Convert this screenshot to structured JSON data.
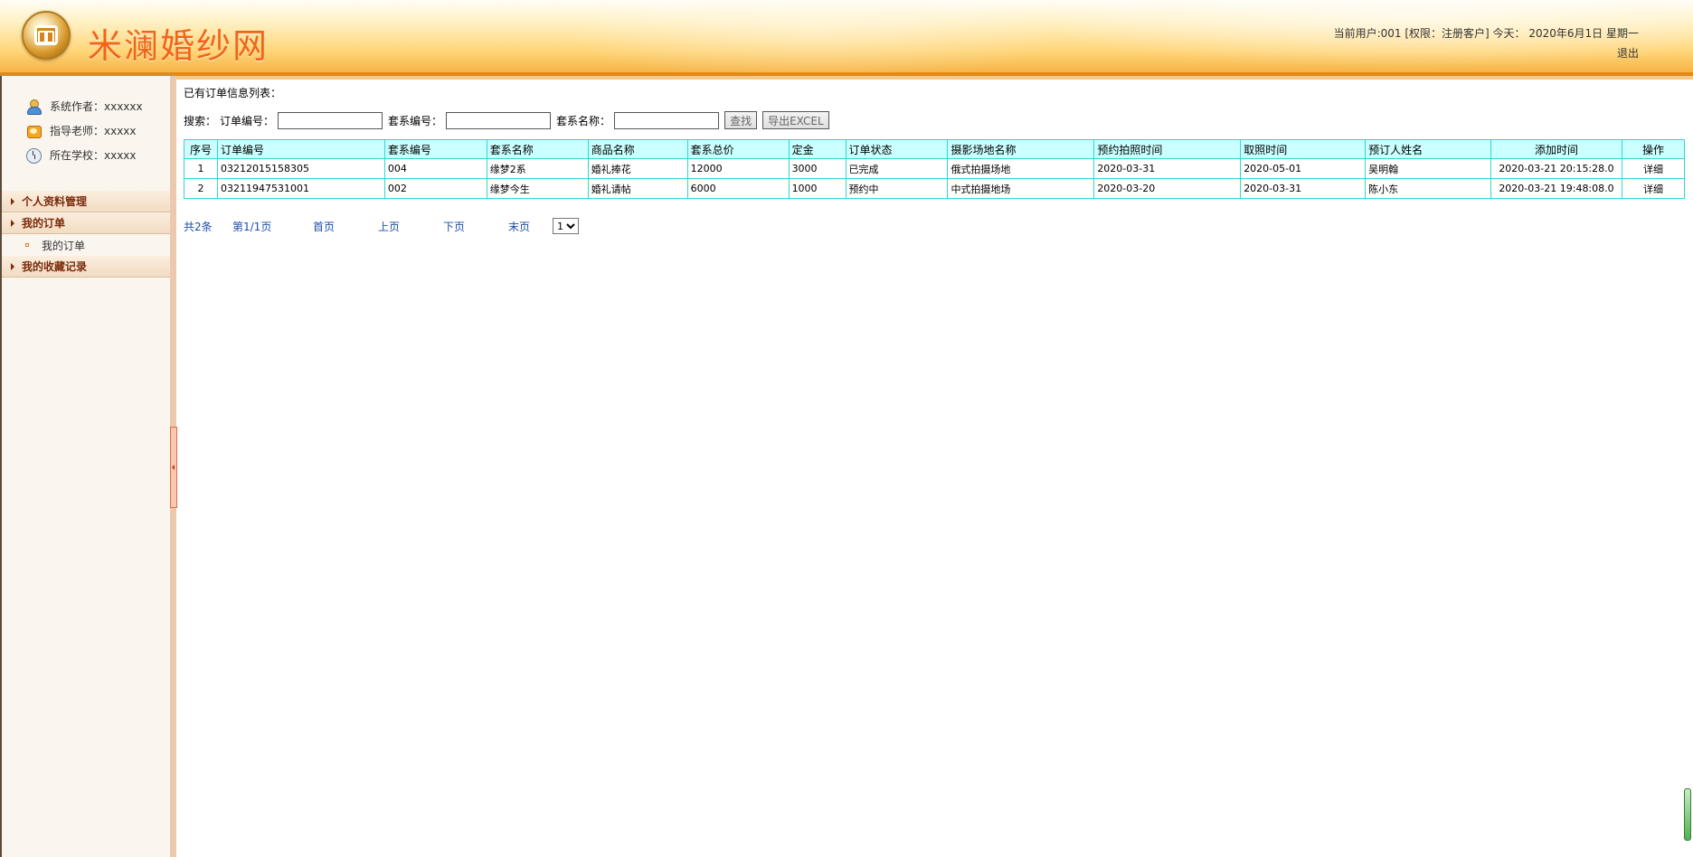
{
  "header": {
    "site_title": "米澜婚纱网",
    "user_line": "当前用户:001 [权限：注册客户] 今天： 2020年6月1日 星期一",
    "logout": "退出",
    "colors": {
      "accent": "#f0651a",
      "bar": "#e08a1c"
    }
  },
  "sidebar": {
    "info": [
      {
        "icon": "author-icon",
        "text": "系统作者：xxxxxx"
      },
      {
        "icon": "teacher-icon",
        "text": "指导老师：xxxxx"
      },
      {
        "icon": "school-icon",
        "text": "所在学校：xxxxx"
      }
    ],
    "menu": {
      "profile": "个人资料管理",
      "orders": "我的订单",
      "orders_sub": "我的订单",
      "favorites": "我的收藏记录"
    }
  },
  "main": {
    "list_title": "已有订单信息列表：",
    "search": {
      "label": "搜索：",
      "order_no_label": "订单编号：",
      "set_no_label": "套系编号：",
      "set_name_label": "套系名称：",
      "order_no_value": "",
      "set_no_value": "",
      "set_name_value": "",
      "find_button": "查找",
      "export_button": "导出EXCEL"
    },
    "table": {
      "headers": [
        "序号",
        "订单编号",
        "套系编号",
        "套系名称",
        "商品名称",
        "套系总价",
        "定金",
        "订单状态",
        "摄影场地名称",
        "预约拍照时间",
        "取照时间",
        "预订人姓名",
        "添加时间",
        "操作"
      ],
      "rows": [
        [
          "1",
          "03212015158305",
          "004",
          "缘梦2系",
          "婚礼捧花",
          "12000",
          "3000",
          "已完成",
          "俄式拍摄场地",
          "2020-03-31",
          "2020-05-01",
          "吴明翰",
          "2020-03-21 20:15:28.0",
          "详细"
        ],
        [
          "2",
          "03211947531001",
          "002",
          "缘梦今生",
          "婚礼请帖",
          "6000",
          "1000",
          "预约中",
          "中式拍摄地场",
          "2020-03-20",
          "2020-03-31",
          "陈小东",
          "2020-03-21 19:48:08.0",
          "详细"
        ]
      ]
    },
    "pager": {
      "total": "共2条",
      "page": "第1/1页",
      "first": "首页",
      "prev": "上页",
      "next": "下页",
      "last": "末页",
      "selected": "1"
    }
  }
}
